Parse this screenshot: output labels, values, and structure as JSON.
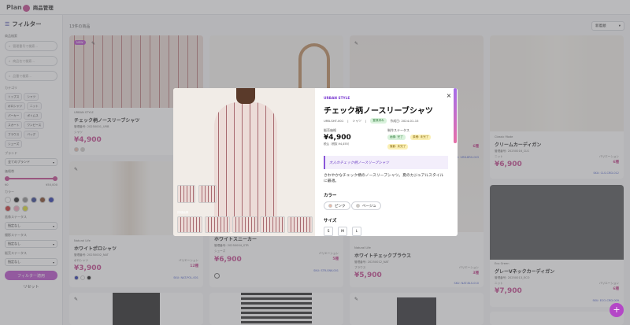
{
  "header": {
    "logo": "Plan",
    "title": "商品管理"
  },
  "sidebar": {
    "title": "フィルター",
    "search_label": "商品検索",
    "search_placeholders": [
      "管理番号で検索...",
      "商品名で検索...",
      "品番で検索..."
    ],
    "category_label": "カテゴリ",
    "categories": [
      "トップス",
      "シャツ",
      "ポロシャツ",
      "ニット",
      "パーカー",
      "ボトムス",
      "スカート",
      "ワンピース",
      "ブラウス",
      "バッグ",
      "シューズ"
    ],
    "brand_label": "ブランド",
    "brand_value": "全てのブランド",
    "price_label": "価格帯",
    "price_min": "¥0",
    "price_max": "¥50,000",
    "color_label": "カラー",
    "colors": [
      "#ffffff",
      "#1a1a1a",
      "#8a8a8a",
      "#2b3a8a",
      "#7a3e1e",
      "#1f2ea8",
      "#c42b2b",
      "#f2a3b8",
      "#d7d72a"
    ],
    "stock_status_label": "画像ステータス",
    "stock_status_value": "指定なし",
    "listing_status_label": "撮影ステータス",
    "listing_status_value": "指定なし",
    "sale_status_label": "販売ステータス",
    "sale_status_value": "指定なし",
    "apply_label": "フィルター適用",
    "reset_label": "リセット"
  },
  "main": {
    "count": "13件の商品",
    "sort_value": "新着順"
  },
  "cards": [
    {
      "brand": "URBAN STYLE",
      "name": "チェック柄ノースリーブシャツ",
      "code": "管理番号: 20250001_URB",
      "price": "¥4,900",
      "category": "シャツ",
      "badge": "NEW"
    },
    {
      "brand": "Natural Life",
      "name": "ホワイトポロシャツ",
      "code": "管理番号: 20250002_NAT",
      "price": "¥3,900",
      "category": "ポロシャツ",
      "stock_label": "バリエーション",
      "stock": "12種",
      "sku": "SKU: NAT-POL-001"
    },
    {
      "brand": "",
      "name": "ホワイトスニーカー",
      "code": "管理番号: 20250004_STR",
      "price": "¥6,900",
      "category": "シューズ",
      "stock_label": "バリエーション",
      "stock": "5種",
      "sku": "SKU: STR-SNK-001"
    },
    {
      "brand": "Natural Life",
      "name": "ホワイトチェックブラウス",
      "code": "管理番号: 20250012_NAT",
      "price": "¥5,900",
      "category": "ブラウス",
      "stock_label": "バリエーション",
      "stock": "3種",
      "sku": "SKU: NAT-BLS-010"
    },
    {
      "brand": "Classic Mode",
      "name": "クリームカーディガン",
      "code": "管理番号: 20250016_CLS",
      "price": "¥6,900",
      "category": "ニット",
      "stock_label": "バリエーション",
      "stock": "6種",
      "sku": "SKU: CLS-CRD-012"
    },
    {
      "brand": "Eco Green",
      "name": "グレーVネックカーディガン",
      "code": "管理番号: 20250013_ECO",
      "price": "¥7,900",
      "category": "ニット",
      "stock_label": "バリエーション",
      "stock": "6種",
      "sku": "SKU: ECO-CRD-009"
    }
  ],
  "partial_cards": {
    "stock": "6種",
    "sku": "SKU: URB-BRS-003"
  },
  "modal": {
    "brand": "URBAN STYLE",
    "title": "チェック柄ノースリーブシャツ",
    "code": "URB-SHT-001",
    "category": "シャツ",
    "status": "登録済み",
    "date": "作成日: 2024-01-15",
    "price_label": "販売価格",
    "price": "¥4,900",
    "tax": "税込（税抜 ¥4,455）",
    "production_label": "制作ステータス",
    "status_image": "画像: 完了",
    "status_text": "原稿: 未完了",
    "status_shoot": "撮影: 未完了",
    "thumbs_label": "詳細画像",
    "catch": "大人のチェック柄ノースリーブシャツ",
    "description": "さわやかなチェック柄のノースリーブシャツ。夏のカジュアルスタイルに最適。",
    "color_label": "カラー",
    "colors": [
      {
        "name": "ピンク",
        "hex": "#e7b9a8"
      },
      {
        "name": "ベージュ",
        "hex": "#cfc9c3"
      }
    ],
    "size_label": "サイズ",
    "sizes": [
      "S",
      "M",
      "L"
    ],
    "close": "×"
  },
  "fab": "+"
}
